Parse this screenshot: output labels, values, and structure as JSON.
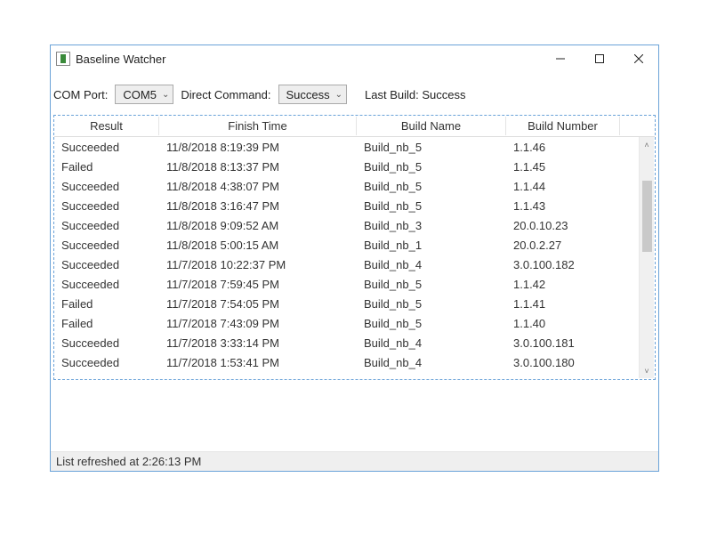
{
  "window": {
    "title": "Baseline Watcher"
  },
  "toolbar": {
    "comport_label": "COM Port:",
    "comport_value": "COM5",
    "direct_label": "Direct Command:",
    "direct_value": "Success",
    "lastbuild_label": "Last Build: Success"
  },
  "table": {
    "columns": {
      "result": "Result",
      "finish": "Finish Time",
      "name": "Build Name",
      "num": "Build Number"
    },
    "rows": [
      {
        "result": "Succeeded",
        "finish": "11/8/2018 8:19:39 PM",
        "name": "Build_nb_5",
        "num": "1.1.46"
      },
      {
        "result": "Failed",
        "finish": "11/8/2018 8:13:37 PM",
        "name": "Build_nb_5",
        "num": "1.1.45"
      },
      {
        "result": "Succeeded",
        "finish": "11/8/2018 4:38:07 PM",
        "name": "Build_nb_5",
        "num": "1.1.44"
      },
      {
        "result": "Succeeded",
        "finish": "11/8/2018 3:16:47 PM",
        "name": "Build_nb_5",
        "num": "1.1.43"
      },
      {
        "result": "Succeeded",
        "finish": "11/8/2018 9:09:52 AM",
        "name": "Build_nb_3",
        "num": "20.0.10.23"
      },
      {
        "result": "Succeeded",
        "finish": "11/8/2018 5:00:15 AM",
        "name": "Build_nb_1",
        "num": "20.0.2.27"
      },
      {
        "result": "Succeeded",
        "finish": "11/7/2018 10:22:37 PM",
        "name": "Build_nb_4",
        "num": "3.0.100.182"
      },
      {
        "result": "Succeeded",
        "finish": "11/7/2018 7:59:45 PM",
        "name": "Build_nb_5",
        "num": "1.1.42"
      },
      {
        "result": "Failed",
        "finish": "11/7/2018 7:54:05 PM",
        "name": "Build_nb_5",
        "num": "1.1.41"
      },
      {
        "result": "Failed",
        "finish": "11/7/2018 7:43:09 PM",
        "name": "Build_nb_5",
        "num": "1.1.40"
      },
      {
        "result": "Succeeded",
        "finish": "11/7/2018 3:33:14 PM",
        "name": "Build_nb_4",
        "num": "3.0.100.181"
      },
      {
        "result": "Succeeded",
        "finish": "11/7/2018 1:53:41 PM",
        "name": "Build_nb_4",
        "num": "3.0.100.180"
      }
    ]
  },
  "status": {
    "text": "List refreshed at 2:26:13 PM"
  }
}
